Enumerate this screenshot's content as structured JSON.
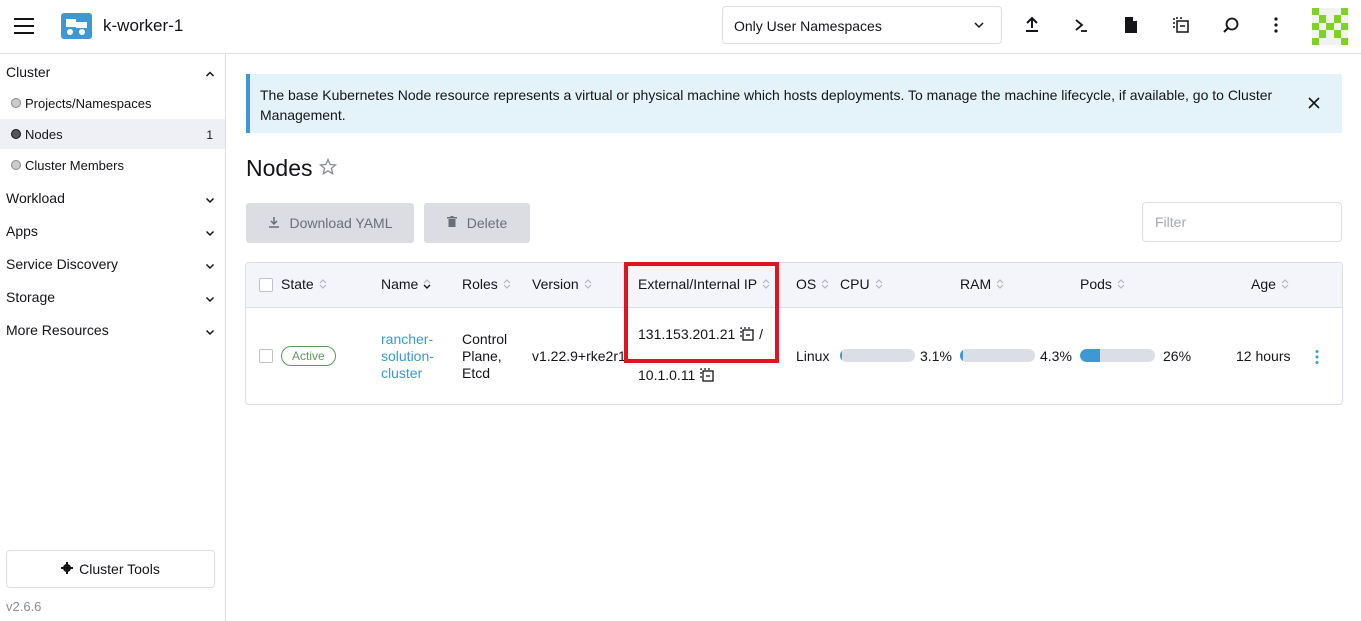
{
  "header": {
    "cluster_name": "k-worker-1",
    "namespace_filter": "Only User Namespaces",
    "icons": [
      "upload-icon",
      "kubectl-shell-icon",
      "file-icon",
      "copy-kubeconfig-icon",
      "search-icon",
      "more-vertical-icon"
    ]
  },
  "sidebar": {
    "groups": [
      {
        "label": "Cluster",
        "expanded": true
      },
      {
        "label": "Workload"
      },
      {
        "label": "Apps"
      },
      {
        "label": "Service Discovery"
      },
      {
        "label": "Storage"
      },
      {
        "label": "More Resources"
      }
    ],
    "cluster_items": [
      {
        "label": "Projects/Namespaces"
      },
      {
        "label": "Nodes",
        "count": "1",
        "active": true
      },
      {
        "label": "Cluster Members"
      }
    ],
    "tools_label": "Cluster Tools",
    "version": "v2.6.6"
  },
  "banner": {
    "text": "The base Kubernetes Node resource represents a virtual or physical machine which hosts deployments. To manage the machine lifecycle, if available, go to Cluster Management."
  },
  "page": {
    "title": "Nodes",
    "download_label": "Download YAML",
    "delete_label": "Delete",
    "filter_placeholder": "Filter"
  },
  "table": {
    "columns": [
      "State",
      "Name",
      "Roles",
      "Version",
      "External/Internal IP",
      "OS",
      "CPU",
      "RAM",
      "Pods",
      "Age"
    ],
    "rows": [
      {
        "state": "Active",
        "name": "rancher-solution-cluster",
        "name_lines": [
          "rancher-",
          "solution-",
          "cluster"
        ],
        "roles": "Control Plane, Etcd",
        "roles_lines": [
          "Control",
          "Plane,",
          "Etcd"
        ],
        "version": "v1.22.9+rke2r1",
        "external_ip": "131.153.201.21",
        "ip_separator": "/",
        "internal_ip": "10.1.0.11",
        "os": "Linux",
        "cpu": "3.1%",
        "cpu_fraction": 0.031,
        "ram": "4.3%",
        "ram_fraction": 0.043,
        "pods": "26%",
        "pods_fraction": 0.26,
        "age": "12 hours"
      }
    ]
  },
  "colors": {
    "accent": "#3d98d3",
    "active_badge": "#5d995d",
    "highlight_box": "#e0141e"
  }
}
